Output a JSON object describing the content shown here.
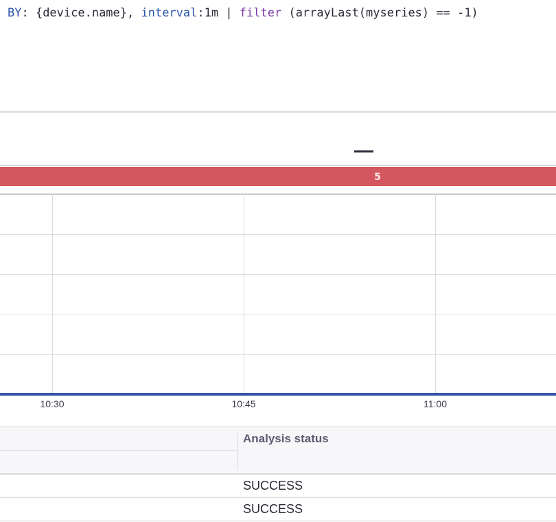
{
  "query": {
    "by_keyword": "BY",
    "by_colon": ": {device.name}, ",
    "interval_keyword": "interval",
    "interval_value": ":1m | ",
    "filter_keyword": "filter",
    "filter_expr": "  (arrayLast(myseries) == -1)"
  },
  "single_value": {
    "value": "—"
  },
  "honeycomb": {
    "value": "5",
    "color": "#d4565f"
  },
  "chart_data": {
    "type": "line",
    "x_tick_labels": [
      "10:30",
      "10:45",
      "11:00"
    ],
    "series": [
      {
        "values": [
          0,
          0,
          0,
          0
        ],
        "color": "#3454a4"
      }
    ],
    "grid": true
  },
  "table": {
    "columns": [
      "Analysis status"
    ],
    "rows": [
      {
        "status": "SUCCESS"
      },
      {
        "status": "SUCCESS"
      }
    ]
  }
}
